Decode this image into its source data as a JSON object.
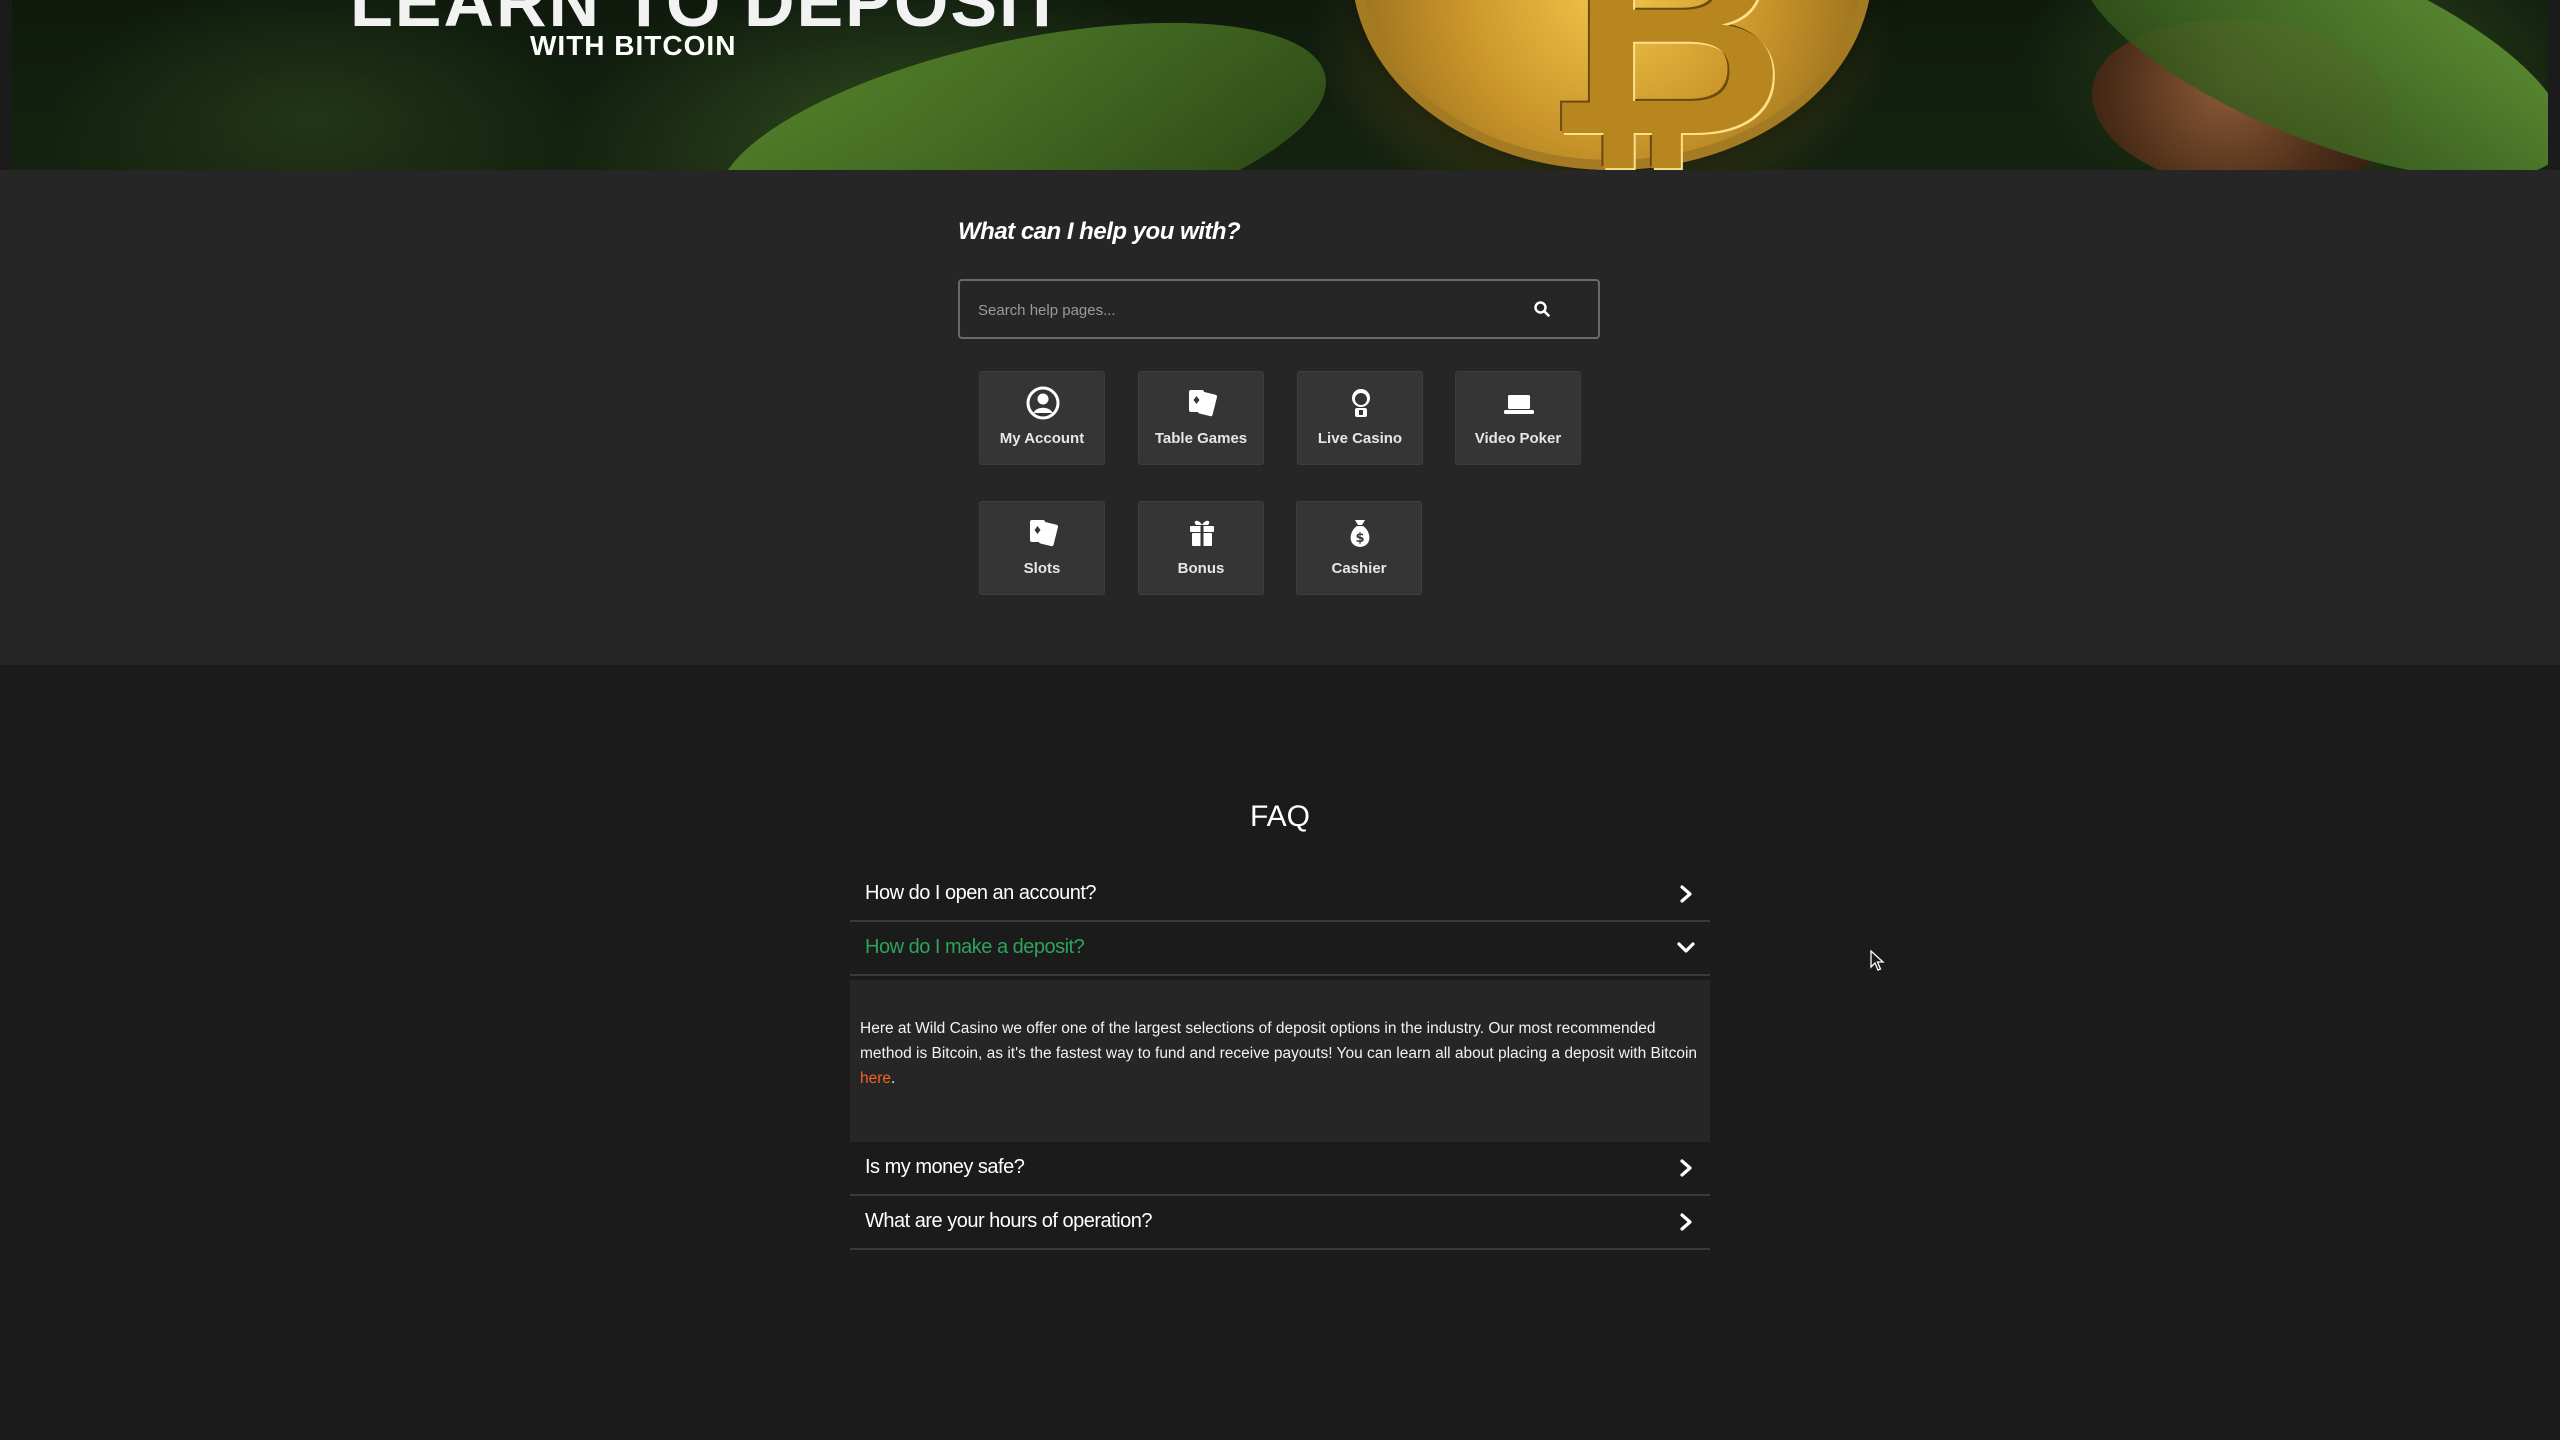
{
  "hero": {
    "title": "LEARN TO DEPOSIT",
    "subtitle": "WITH BITCOIN",
    "coin_symbol": "₿"
  },
  "help": {
    "heading": "What can I help you with?",
    "search_placeholder": "Search help pages...",
    "categories": [
      {
        "label": "My Account",
        "icon": "user-circle-icon"
      },
      {
        "label": "Table Games",
        "icon": "cards-icon"
      },
      {
        "label": "Live Casino",
        "icon": "dealer-icon"
      },
      {
        "label": "Video Poker",
        "icon": "laptop-icon"
      },
      {
        "label": "Slots",
        "icon": "cards-icon"
      },
      {
        "label": "Bonus",
        "icon": "gift-icon"
      },
      {
        "label": "Cashier",
        "icon": "money-bag-icon"
      }
    ]
  },
  "faq": {
    "title": "FAQ",
    "items": [
      {
        "question": "How do I open an account?",
        "state": "collapsed"
      },
      {
        "question": "How do I make a deposit?",
        "state": "expanded"
      },
      {
        "question": "Is my money safe?",
        "state": "collapsed"
      },
      {
        "question": "What are your hours of operation?",
        "state": "collapsed"
      }
    ],
    "answer": {
      "text": "Here at Wild Casino we offer one of the largest selections of deposit options in the industry. Our most recommended method is Bitcoin, as it's the fastest way to fund and receive payouts! You can learn all about placing a deposit with Bitcoin ",
      "link_text": "here",
      "suffix": "."
    }
  },
  "colors": {
    "page_bg": "#1b1b1b",
    "section_bg": "#262626",
    "tile_bg": "#353535",
    "active_question": "#2ea35a",
    "link": "#f26522"
  }
}
